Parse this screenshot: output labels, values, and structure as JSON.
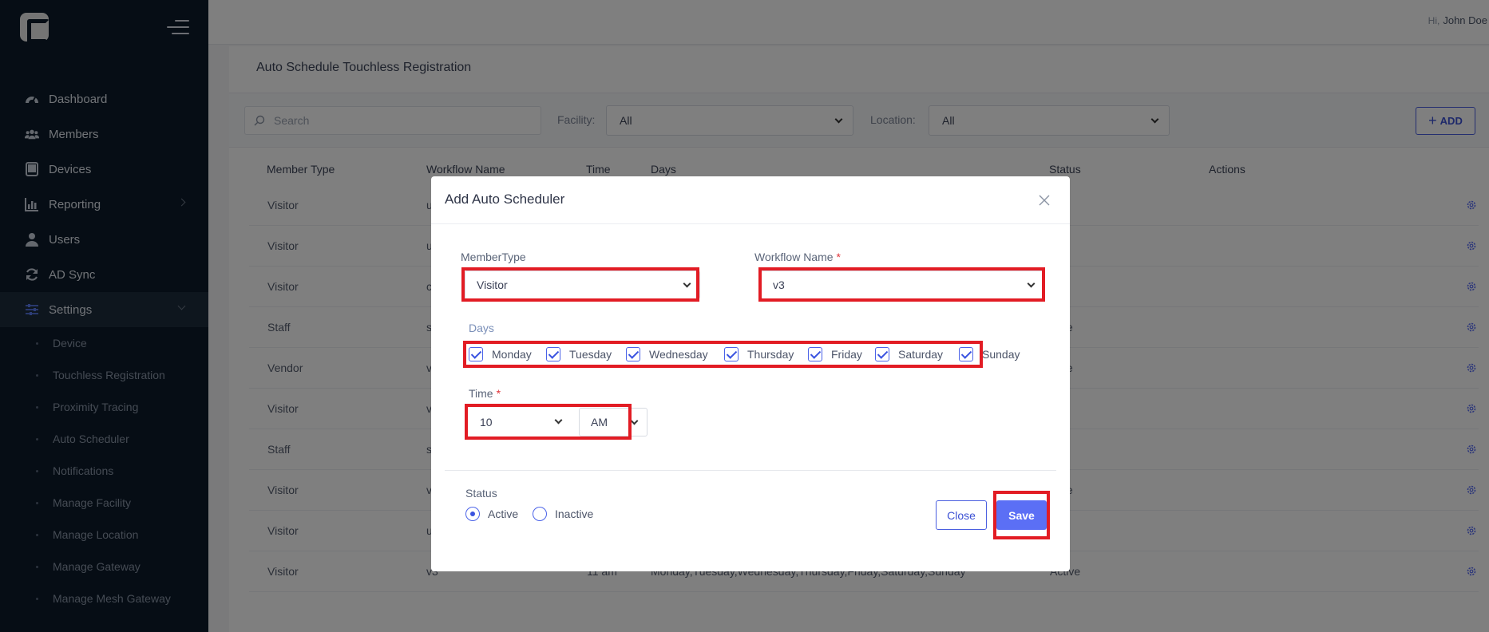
{
  "user": {
    "greeting": "Hi,",
    "name": "John Doe"
  },
  "sidebar": {
    "items": [
      {
        "label": "Dashboard",
        "icon": "dashboard-icon"
      },
      {
        "label": "Members",
        "icon": "members-icon"
      },
      {
        "label": "Devices",
        "icon": "devices-icon"
      },
      {
        "label": "Reporting",
        "icon": "reporting-icon"
      },
      {
        "label": "Users",
        "icon": "user-icon"
      },
      {
        "label": "AD Sync",
        "icon": "sync-icon"
      },
      {
        "label": "Settings",
        "icon": "settings-sliders-icon"
      }
    ],
    "subitems": [
      "Device",
      "Touchless Registration",
      "Proximity Tracing",
      "Auto Scheduler",
      "Notifications",
      "Manage Facility",
      "Manage Location",
      "Manage Gateway",
      "Manage Mesh Gateway"
    ]
  },
  "page": {
    "title": "Auto Schedule Touchless Registration",
    "search_placeholder": "Search",
    "facility_label": "Facility:",
    "facility_value": "All",
    "location_label": "Location:",
    "location_value": "All",
    "add_label": "ADD"
  },
  "table": {
    "headers": [
      "Member Type",
      "Workflow Name",
      "Time",
      "Days",
      "Status",
      "Actions"
    ],
    "rows": [
      {
        "member_type": "Visitor",
        "workflow": "u",
        "time": "",
        "days": "",
        "status": "ive"
      },
      {
        "member_type": "Visitor",
        "workflow": "u",
        "time": "",
        "days": "",
        "status": "ive"
      },
      {
        "member_type": "Visitor",
        "workflow": "c",
        "time": "",
        "days": "",
        "status": "ive"
      },
      {
        "member_type": "Staff",
        "workflow": "s",
        "time": "",
        "days": "",
        "status": "ctive"
      },
      {
        "member_type": "Vendor",
        "workflow": "v",
        "time": "",
        "days": "",
        "status": "ctive"
      },
      {
        "member_type": "Visitor",
        "workflow": "v",
        "time": "",
        "days": "",
        "status": "ive"
      },
      {
        "member_type": "Staff",
        "workflow": "s",
        "time": "",
        "days": "",
        "status": "ive"
      },
      {
        "member_type": "Visitor",
        "workflow": "v",
        "time": "",
        "days": "",
        "status": "ctive"
      },
      {
        "member_type": "Visitor",
        "workflow": "u",
        "time": "",
        "days": "",
        "status": "ive"
      },
      {
        "member_type": "Visitor",
        "workflow": "v3",
        "time": "11 am",
        "days": "Monday,Tuesday,Wednesday,Thursday,Friday,Saturday,Sunday",
        "status": "Active"
      }
    ]
  },
  "modal": {
    "title": "Add Auto Scheduler",
    "member_type_label": "MemberType",
    "member_type_value": "Visitor",
    "workflow_label": "Workflow Name",
    "workflow_value": "v3",
    "required_mark": "*",
    "days_label": "Days",
    "days": [
      {
        "label": "Monday",
        "checked": true
      },
      {
        "label": "Tuesday",
        "checked": true
      },
      {
        "label": "Wednesday",
        "checked": true
      },
      {
        "label": "Thursday",
        "checked": true
      },
      {
        "label": "Friday",
        "checked": true
      },
      {
        "label": "Saturday",
        "checked": true
      },
      {
        "label": "Sunday",
        "checked": true
      }
    ],
    "time_label": "Time",
    "hour_value": "10",
    "ampm_value": "AM",
    "status_label": "Status",
    "status_options": [
      "Active",
      "Inactive"
    ],
    "status_selected": "Active",
    "close_label": "Close",
    "save_label": "Save"
  },
  "colors": {
    "sidebar_bg": "#0c1b2b",
    "accent": "#4b63e8",
    "highlight": "#e21c24"
  }
}
